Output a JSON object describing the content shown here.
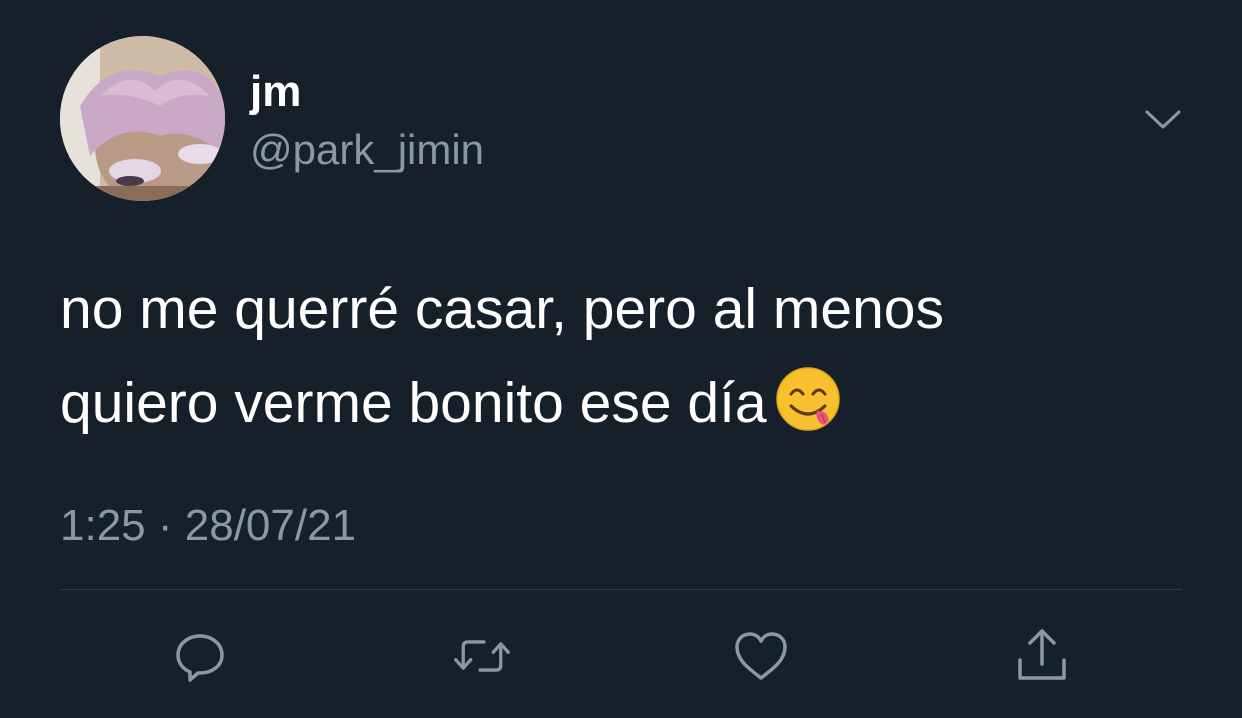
{
  "author": {
    "display_name": "jm",
    "handle": "@park_jimin",
    "avatar_icon": "profile-photo"
  },
  "tweet": {
    "text": "no me querré casar, pero al menos\nquiero verme bonito ese día",
    "emoji": "face-savoring-food-emoji"
  },
  "meta": {
    "time": "1:25",
    "separator": "·",
    "date": "28/07/21"
  },
  "actions": {
    "reply_icon": "reply-icon",
    "retweet_icon": "retweet-icon",
    "like_icon": "heart-icon",
    "share_icon": "share-icon"
  },
  "colors": {
    "background": "#16202b",
    "text_primary": "#ffffff",
    "text_secondary": "#8899a6",
    "divider": "#2f3b47"
  }
}
